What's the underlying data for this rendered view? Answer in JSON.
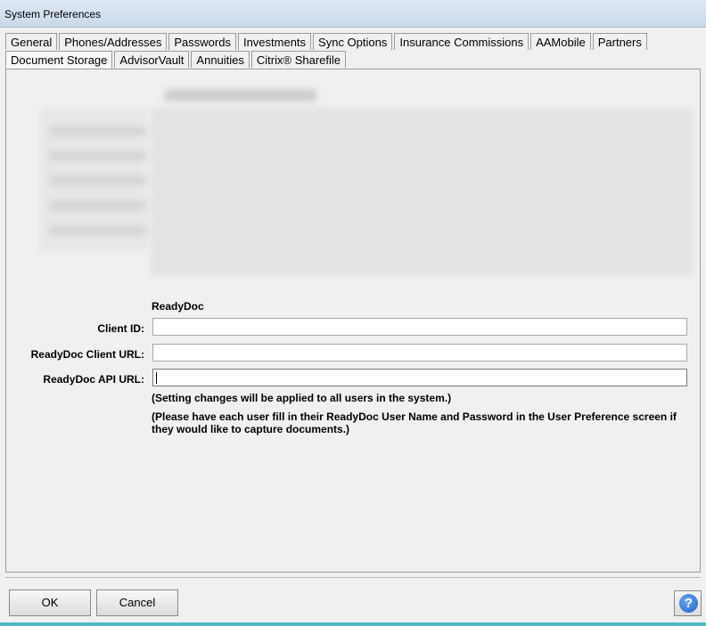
{
  "window": {
    "title": "System Preferences"
  },
  "tabs": {
    "row1": [
      "General",
      "Phones/Addresses",
      "Passwords",
      "Investments",
      "Sync Options",
      "Insurance Commissions",
      "AAMobile",
      "Partners"
    ],
    "row2": [
      "Document Storage",
      "AdvisorVault",
      "Annuities",
      "Citrix® Sharefile"
    ],
    "active": "Document Storage"
  },
  "readydoc": {
    "section_title": "ReadyDoc",
    "client_id_label": "Client ID:",
    "client_id_value": "",
    "client_url_label": "ReadyDoc Client URL:",
    "client_url_value": "",
    "api_url_label": "ReadyDoc API URL:",
    "api_url_value": "",
    "note1": "(Setting changes will be applied to all users in the system.)",
    "note2": "(Please have each user fill in their ReadyDoc User Name and Password in the User Preference screen if they would like to capture documents.)"
  },
  "buttons": {
    "ok": "OK",
    "cancel": "Cancel",
    "help_icon": "help-question-icon",
    "help_glyph": "?"
  },
  "colors": {
    "accent": "#4fb8c0",
    "help": "#1f5fc4"
  }
}
